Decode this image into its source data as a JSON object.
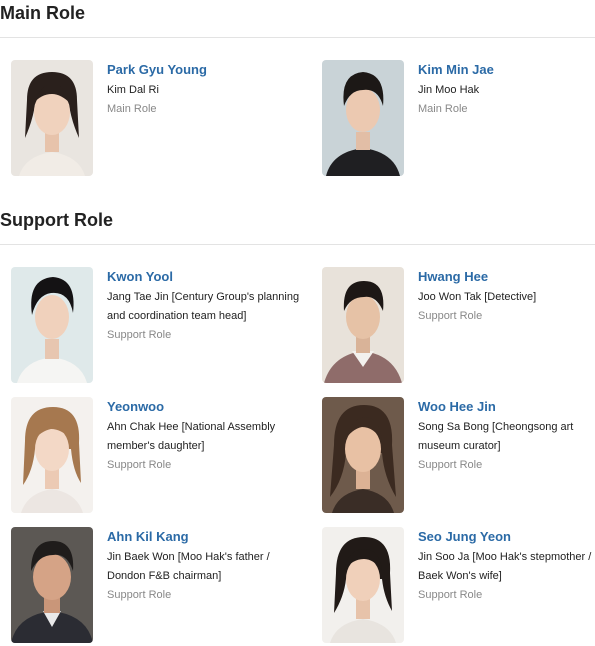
{
  "sections": {
    "main": {
      "title": "Main Role",
      "cast": [
        {
          "actor": "Park Gyu Young",
          "character": "Kim Dal Ri",
          "role": "Main Role"
        },
        {
          "actor": "Kim Min Jae",
          "character": "Jin Moo Hak",
          "role": "Main Role"
        }
      ]
    },
    "support": {
      "title": "Support Role",
      "cast": [
        {
          "actor": "Kwon Yool",
          "character": "Jang Tae Jin [Century Group's planning and coordination team head]",
          "role": "Support Role"
        },
        {
          "actor": "Hwang Hee",
          "character": "Joo Won Tak [Detective]",
          "role": "Support Role"
        },
        {
          "actor": "Yeonwoo",
          "character": "Ahn Chak Hee [National Assembly member's daughter]",
          "role": "Support Role"
        },
        {
          "actor": "Woo Hee Jin",
          "character": "Song Sa Bong [Cheongsong art museum curator]",
          "role": "Support Role"
        },
        {
          "actor": "Ahn Kil Kang",
          "character": "Jin Baek Won [Moo Hak's father / Dondon F&B chairman]",
          "role": "Support Role"
        },
        {
          "actor": "Seo Jung Yeon",
          "character": "Jin Soo Ja [Moo Hak's stepmother / Baek Won's wife]",
          "role": "Support Role"
        }
      ]
    }
  },
  "colors": {
    "actor_link": "#2b6aa6",
    "role_text": "#888888",
    "divider": "#e3e3e3"
  }
}
